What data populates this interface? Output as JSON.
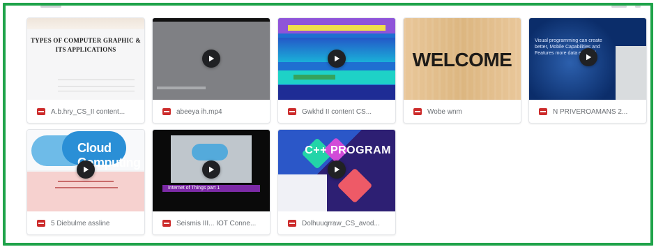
{
  "cards": [
    {
      "caption": "A.b.hry_CS_II content...",
      "thumbnail_title": "TYPES OF COMPUTER GRAPHIC & ITS APPLICATIONS",
      "has_play": false
    },
    {
      "caption": "abeeya ih.mp4",
      "has_play": true
    },
    {
      "caption": "Gwkhd II content CS...",
      "has_play": true
    },
    {
      "caption": "Wobe wnm",
      "thumbnail_title": "WELCOME",
      "has_play": false
    },
    {
      "caption": "N PRIVEROAMANS 2...",
      "thumbnail_text": "Visual programming can create better, Mobile Capabilities and Features more data enabled",
      "has_play": true
    },
    {
      "caption": "5 Diebulme assline",
      "thumbnail_title": "Cloud Computing",
      "has_play": true
    },
    {
      "caption": "Seismis III... IOT Conne...",
      "thumbnail_text": "Internet of Things part 1",
      "has_play": true
    },
    {
      "caption": "Dolhuuqrraw_CS_avod...",
      "thumbnail_title": "C++ PROGRAM",
      "has_play": true
    }
  ],
  "colors": {
    "border_green": "#1fa34a",
    "file_icon_red": "#cc2b2b"
  }
}
